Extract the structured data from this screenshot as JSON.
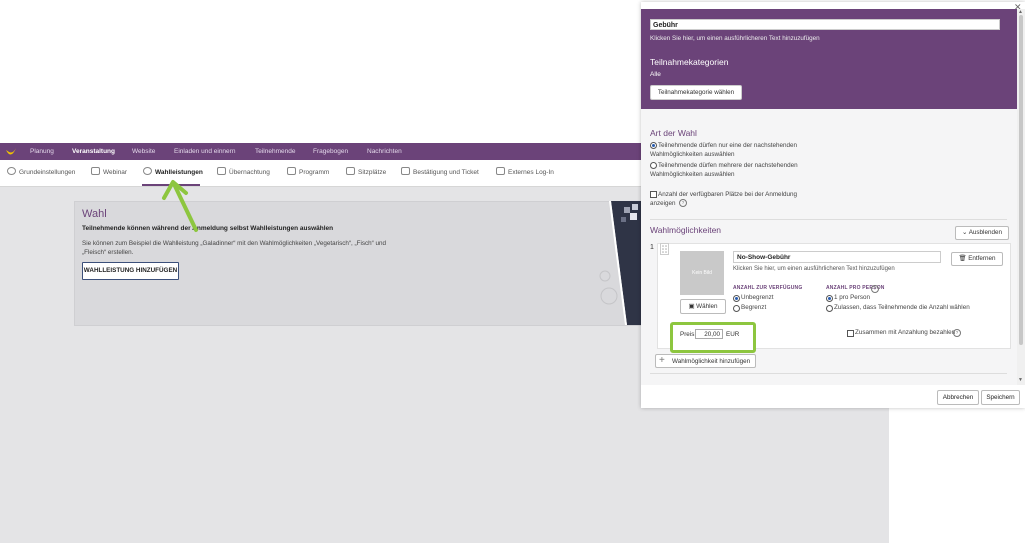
{
  "topnav": {
    "items": [
      "Planung",
      "Veranstaltung",
      "Website",
      "Einladen und einnern",
      "Teilnehmende",
      "Fragebogen",
      "Nachrichten"
    ],
    "active": "Veranstaltung"
  },
  "subnav": {
    "items": [
      "Grundeinstellungen",
      "Webinar",
      "Wahlleistungen",
      "Übernachtung",
      "Programm",
      "Sitzplätze",
      "Bestätigung und Ticket",
      "Externes Log-In"
    ],
    "active": "Wahlleistungen"
  },
  "card": {
    "title": "Wahl",
    "subtitle": "Teilnehmende können während der Anmeldung selbst Wahlleistungen auswählen",
    "text": "Sie können zum Beispiel die Wahlleistung „Galadinner“ mit den Wahlmöglichkeiten „Vegetarisch“, „Fisch“ und „Fleisch“ erstellen.",
    "button": "WAHLLEISTUNG HINZUFÜGEN"
  },
  "dialog": {
    "title_value": "Gebühr",
    "title_hint": "Klicken Sie hier, um einen ausführlicheren Text hinzuzufügen",
    "categories": {
      "heading": "Teilnahmekategorien",
      "value": "Alle",
      "button": "Teilnahmekategorie wählen"
    },
    "choice_type": {
      "heading": "Art der Wahl",
      "option1": "Teilnehmende dürfen nur eine der nachstehenden Wahlmöglichkeiten auswählen",
      "option2": "Teilnehmende dürfen mehrere der nachstehenden Wahlmöglichkeiten auswählen",
      "selected": 1,
      "seats_checkbox": "Anzahl der verfügbaren Plätze bei der Anmeldung anzeigen"
    },
    "options": {
      "heading": "Wahlmöglichkeiten",
      "hide_button": "Ausblenden",
      "item": {
        "number": "1",
        "name": "No-Show-Gebühr",
        "hint": "Klicken Sie hier, um einen ausführlicheren Text hinzuzufügen",
        "remove_button": "Entfernen",
        "image_placeholder": "Kein Bild",
        "choose_button": "Wählen",
        "availability_heading": "ANZAHL ZUR VERFÜGUNG",
        "availability_opt1": "Unbegrenzt",
        "availability_opt2": "Begrenzt",
        "per_person_heading": "ANZAHL PRO PERSON",
        "per_person_opt1": "1 pro Person",
        "per_person_opt2": "Zulassen, dass Teilnehmende die Anzahl wählen",
        "price_label": "Preis:",
        "price_value": "20,00",
        "currency": "EUR",
        "deposit_label": "Zusammen mit Anzahlung bezahlen"
      },
      "add_button": "Wahlmöglichkeit hinzufügen"
    },
    "cancel_button": "Abbrechen",
    "save_button": "Speichern"
  },
  "colors": {
    "brand": "#6b4379",
    "highlight": "#8dc63f"
  }
}
